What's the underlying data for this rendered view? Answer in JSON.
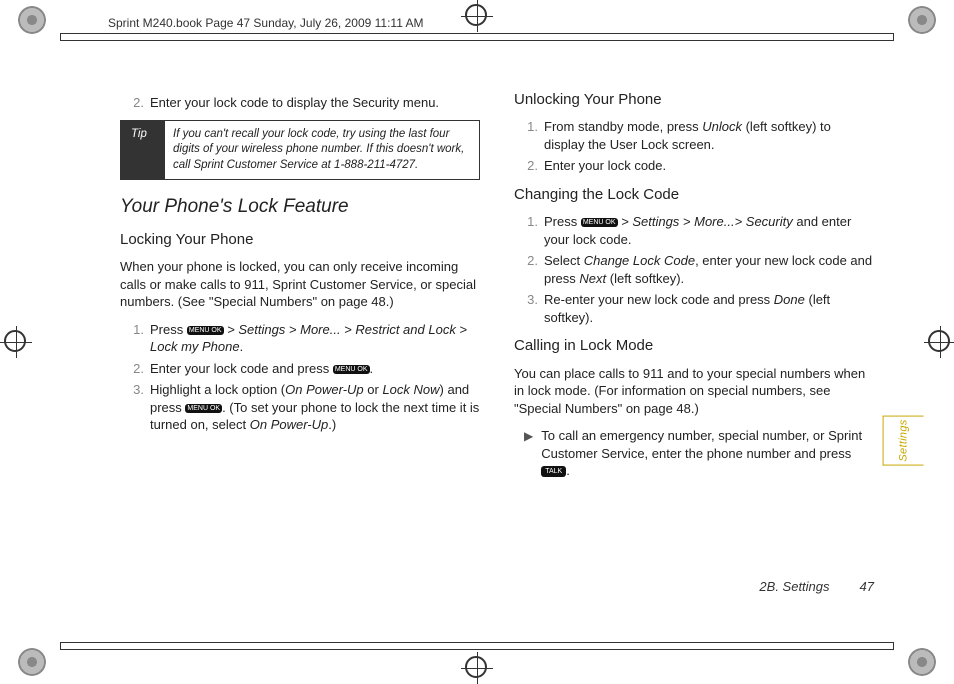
{
  "header": "Sprint M240.book  Page 47  Sunday, July 26, 2009  11:11 AM",
  "left": {
    "step2": "Enter your lock code to display the Security menu.",
    "tip_label": "Tip",
    "tip_text": "If you can't recall your lock code, try using the last four digits of your wireless phone number. If this doesn't work, call Sprint Customer Service at 1-888-211-4727.",
    "section": "Your Phone's Lock Feature",
    "sub1": "Locking Your Phone",
    "para1": "When your phone is locked, you can only receive incoming calls or make calls to 911, Sprint Customer Service, or special numbers. (See \"Special Numbers\" on page 48.)",
    "s1_pre": "Press ",
    "s1_path": " > Settings > More... > Restrict and Lock > Lock my Phone",
    "s2_pre": "Enter your lock code and press ",
    "s3_a": "Highlight a lock option (",
    "s3_opt1": "On Power-Up",
    "s3_or": " or ",
    "s3_opt2": "Lock Now",
    "s3_b": ") and press ",
    "s3_c": ". (To set your phone to lock the next time it is turned on, select ",
    "s3_opt3": "On Power-Up",
    "s3_d": ".)"
  },
  "right": {
    "sub1": "Unlocking Your Phone",
    "r1_a": "From standby mode, press ",
    "r1_unlock": "Unlock",
    "r1_b": " (left softkey) to display the User Lock screen.",
    "r2": "Enter your lock code.",
    "sub2": "Changing the Lock Code",
    "c1_pre": "Press ",
    "c1_path": " > Settings > More...> Security",
    "c1_post": " and enter your lock code.",
    "c2_a": "Select ",
    "c2_opt": "Change Lock Code",
    "c2_b": ", enter your new lock code and press ",
    "c2_next": "Next",
    "c2_c": " (left softkey).",
    "c3_a": "Re-enter your new lock code and press ",
    "c3_done": "Done",
    "c3_b": " (left softkey).",
    "sub3": "Calling in Lock Mode",
    "para3": "You can place calls to 911 and to your special numbers when in lock mode. (For information on special numbers, see \"Special Numbers\" on page 48.)",
    "bullet_a": "To call an emergency number, special number, or Sprint Customer Service, enter the phone number and press ",
    "bullet_b": "."
  },
  "keys": {
    "menu": "MENU\nOK",
    "talk": "TALK"
  },
  "footer": {
    "section": "2B. Settings",
    "page": "47"
  },
  "side_tab": "Settings",
  "nums": {
    "n1": "1.",
    "n2": "2.",
    "n3": "3."
  },
  "period": "."
}
